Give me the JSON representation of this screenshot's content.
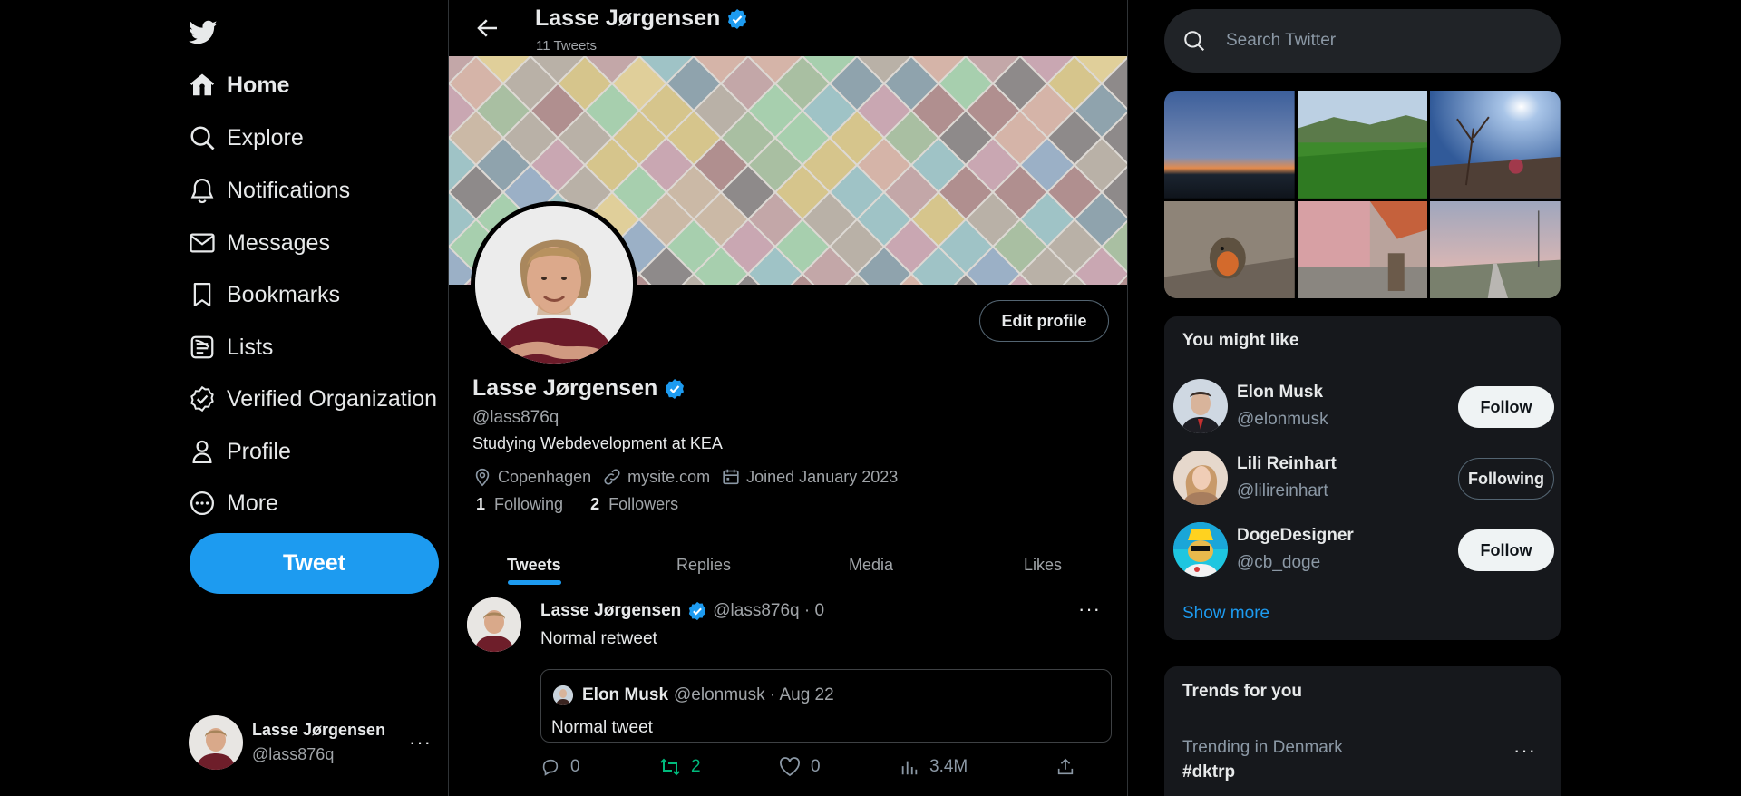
{
  "nav": {
    "items": [
      {
        "label": "Home",
        "icon": "home-icon",
        "active": true
      },
      {
        "label": "Explore",
        "icon": "search-icon"
      },
      {
        "label": "Notifications",
        "icon": "bell-icon"
      },
      {
        "label": "Messages",
        "icon": "envelope-icon"
      },
      {
        "label": "Bookmarks",
        "icon": "bookmark-icon"
      },
      {
        "label": "Lists",
        "icon": "list-icon"
      },
      {
        "label": "Verified Organization",
        "icon": "verified-org-icon"
      },
      {
        "label": "Profile",
        "icon": "person-icon"
      },
      {
        "label": "More",
        "icon": "more-circle-icon"
      }
    ],
    "tweet_label": "Tweet",
    "account": {
      "name": "Lasse Jørgensen",
      "handle": "@lass876q",
      "more": "···"
    }
  },
  "header": {
    "title": "Lasse Jørgensen",
    "subtitle": "11 Tweets"
  },
  "profile": {
    "edit_label": "Edit profile",
    "name": "Lasse Jørgensen",
    "handle": "@lass876q",
    "bio": "Studying Webdevelopment at KEA",
    "location": "Copenhagen",
    "website": "mysite.com",
    "joined": "Joined January 2023",
    "following_count": "1",
    "following_label": "Following",
    "followers_count": "2",
    "followers_label": "Followers"
  },
  "tabs": [
    {
      "label": "Tweets",
      "active": true
    },
    {
      "label": "Replies"
    },
    {
      "label": "Media"
    },
    {
      "label": "Likes"
    }
  ],
  "tweet": {
    "name": "Lasse Jørgensen",
    "meta": "@lass876q · 0",
    "more": "···",
    "text": "Normal retweet",
    "quote": {
      "name": "Elon Musk",
      "meta": "@elonmusk · Aug 22",
      "text": "Normal tweet"
    },
    "replies": "0",
    "retweets": "2",
    "likes": "0",
    "views": "3.4M"
  },
  "search": {
    "placeholder": "Search Twitter"
  },
  "who_to_follow": {
    "title": "You might like",
    "users": [
      {
        "name": "Elon Musk",
        "handle": "@elonmusk",
        "button": "Follow",
        "following": false
      },
      {
        "name": "Lili Reinhart",
        "handle": "@lilireinhart",
        "button": "Following",
        "following": true
      },
      {
        "name": "DogeDesigner",
        "handle": "@cb_doge",
        "button": "Follow",
        "following": false
      }
    ],
    "show_more": "Show more"
  },
  "trends": {
    "title": "Trends for you",
    "context": "Trending in Denmark",
    "tag": "#dktrp",
    "more": "···"
  },
  "colors": {
    "accent": "#1d9bf0",
    "retweet": "#00ba7c",
    "background": "#000000",
    "card": "#16181c",
    "muted": "#8b98a5"
  }
}
